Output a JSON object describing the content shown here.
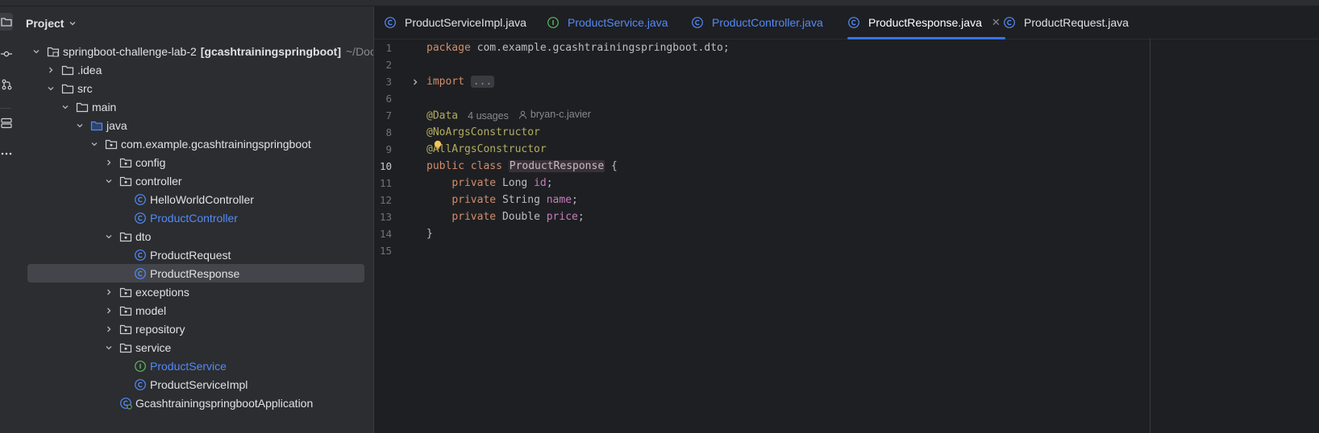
{
  "project_panel": {
    "title": "Project",
    "tree": [
      {
        "label": "springboot-challenge-lab-2",
        "module": "[gcashtrainingspringboot]",
        "path": "~/Docume",
        "icon": "module-folder-icon",
        "expanded": true
      },
      {
        "label": ".idea",
        "icon": "folder-icon",
        "expanded": false
      },
      {
        "label": "src",
        "icon": "folder-icon",
        "expanded": true
      },
      {
        "label": "main",
        "icon": "folder-icon",
        "expanded": true
      },
      {
        "label": "java",
        "icon": "source-folder-icon",
        "expanded": true
      },
      {
        "label": "com.example.gcashtrainingspringboot",
        "icon": "package-icon",
        "expanded": true
      },
      {
        "label": "config",
        "icon": "package-icon",
        "expanded": false
      },
      {
        "label": "controller",
        "icon": "package-icon",
        "expanded": true
      },
      {
        "label": "HelloWorldController",
        "icon": "class-icon"
      },
      {
        "label": "ProductController",
        "icon": "class-icon",
        "modified": true
      },
      {
        "label": "dto",
        "icon": "package-icon",
        "expanded": true
      },
      {
        "label": "ProductRequest",
        "icon": "class-icon"
      },
      {
        "label": "ProductResponse",
        "icon": "class-icon",
        "selected": true
      },
      {
        "label": "exceptions",
        "icon": "package-icon",
        "expanded": false
      },
      {
        "label": "model",
        "icon": "package-icon",
        "expanded": false
      },
      {
        "label": "repository",
        "icon": "package-icon",
        "expanded": false
      },
      {
        "label": "service",
        "icon": "package-icon",
        "expanded": true
      },
      {
        "label": "ProductService",
        "icon": "interface-icon",
        "modified": true
      },
      {
        "label": "ProductServiceImpl",
        "icon": "class-icon"
      },
      {
        "label": "GcashtrainingspringbootApplication",
        "icon": "spring-class-icon"
      }
    ]
  },
  "tabs": [
    {
      "label": "ProductServiceImpl.java",
      "icon": "class-icon",
      "modified": false,
      "active": false
    },
    {
      "label": "ProductService.java",
      "icon": "interface-icon",
      "modified": true,
      "active": false
    },
    {
      "label": "ProductController.java",
      "icon": "class-icon",
      "modified": true,
      "active": false
    },
    {
      "label": "ProductResponse.java",
      "icon": "class-icon",
      "modified": false,
      "active": true
    },
    {
      "label": "ProductRequest.java",
      "icon": "class-icon",
      "modified": false,
      "active": false
    }
  ],
  "editor": {
    "current_line": "10",
    "lines": [
      {
        "num": "1",
        "parts": [
          [
            "kw",
            "package "
          ],
          [
            "plain",
            "com.example.gcashtrainingspringboot.dto;"
          ]
        ]
      },
      {
        "num": "2",
        "parts": []
      },
      {
        "num": "3",
        "parts": [
          [
            "kw",
            "import "
          ],
          [
            "folded",
            "..."
          ]
        ],
        "foldable": true
      },
      {
        "num": "6",
        "parts": []
      },
      {
        "num": "7",
        "parts": [
          [
            "ann",
            "@Data"
          ]
        ],
        "usages": "4 usages",
        "author": "bryan-c.javier"
      },
      {
        "num": "8",
        "parts": [
          [
            "ann",
            "@NoArgsConstructor"
          ]
        ]
      },
      {
        "num": "9",
        "parts": [
          [
            "ann",
            "@AllArgsConstructor"
          ]
        ]
      },
      {
        "num": "10",
        "parts": [
          [
            "kw",
            "public class "
          ],
          [
            "cls",
            "ProductResponse"
          ],
          [
            "plain",
            " {"
          ]
        ]
      },
      {
        "num": "11",
        "parts": [
          [
            "plain",
            "    "
          ],
          [
            "kw",
            "private "
          ],
          [
            "plain",
            "Long "
          ],
          [
            "fld",
            "id"
          ],
          [
            "plain",
            ";"
          ]
        ]
      },
      {
        "num": "12",
        "parts": [
          [
            "plain",
            "    "
          ],
          [
            "kw",
            "private "
          ],
          [
            "plain",
            "String "
          ],
          [
            "fld",
            "name"
          ],
          [
            "plain",
            ";"
          ]
        ]
      },
      {
        "num": "13",
        "parts": [
          [
            "plain",
            "    "
          ],
          [
            "kw",
            "private "
          ],
          [
            "plain",
            "Double "
          ],
          [
            "fld",
            "price"
          ],
          [
            "plain",
            ";"
          ]
        ]
      },
      {
        "num": "14",
        "parts": [
          [
            "plain",
            "}"
          ]
        ]
      },
      {
        "num": "15",
        "parts": []
      }
    ]
  },
  "colors": {
    "accent": "#3574f0",
    "modified_file": "#548af7",
    "class_icon": "#548af7",
    "interface_icon": "#5fb865",
    "keyword": "#cf8e6d",
    "annotation": "#b3ae60",
    "field": "#c77dbb"
  }
}
